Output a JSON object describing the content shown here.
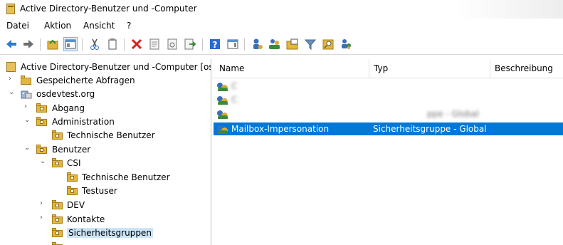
{
  "window": {
    "title": "Active Directory-Benutzer und -Computer"
  },
  "menu": [
    "Datei",
    "Aktion",
    "Ansicht",
    "?"
  ],
  "toolbar": [
    "back-icon",
    "forward-icon",
    "up-icon",
    "show-hide-console-tree-icon",
    "cut-icon",
    "copy-icon",
    "delete-icon",
    "properties-icon",
    "refresh-icon",
    "export-list-icon",
    "help-icon",
    "show-action-pane-icon",
    "new-user-icon",
    "new-group-icon",
    "new-ou-icon",
    "filter-icon",
    "find-icon",
    "add-to-group-icon"
  ],
  "tree": {
    "items": [
      {
        "label": "Active Directory-Benutzer und -Computer [os"
      },
      {
        "label": "Gespeicherte Abfragen"
      },
      {
        "label": "osdevtest.org"
      },
      {
        "label": "Abgang"
      },
      {
        "label": "Administration"
      },
      {
        "label": "Technische Benutzer"
      },
      {
        "label": "Benutzer"
      },
      {
        "label": "CSI"
      },
      {
        "label": "Technische Benutzer"
      },
      {
        "label": "Testuser"
      },
      {
        "label": "DEV"
      },
      {
        "label": "Kontakte"
      },
      {
        "label": "Sicherheitsgruppen"
      }
    ]
  },
  "list": {
    "columns": [
      "Name",
      "Typ",
      "Beschreibung"
    ],
    "rows": [
      {
        "name": "C",
        "type": "",
        "desc": ""
      },
      {
        "name": "C",
        "type": "",
        "desc": ""
      },
      {
        "name": "",
        "type": "ppe - Global",
        "desc": ""
      },
      {
        "name": "Mailbox-Impersonation",
        "type": "Sicherheitsgruppe - Global",
        "desc": ""
      }
    ]
  }
}
